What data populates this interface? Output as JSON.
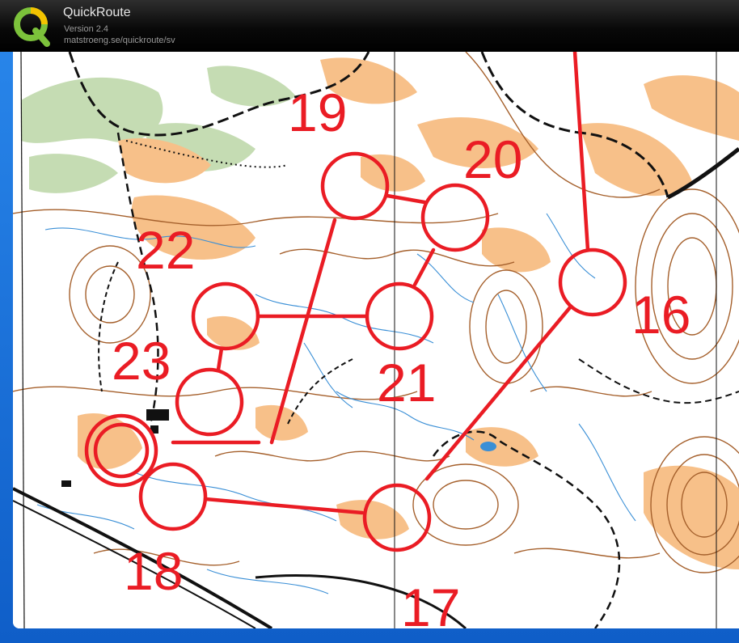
{
  "app": {
    "name": "QuickRoute",
    "version": "Version 2.4",
    "url": "matstroeng.se/quickroute/sv",
    "logo_letter": "Q"
  },
  "colors": {
    "course": "#ea1c24",
    "open_land": "#f7c089",
    "green": "#c5dcb3",
    "contour": "#a5602c",
    "water": "#3a8fd6",
    "path": "#111111"
  },
  "course": {
    "controls": [
      {
        "number": "16"
      },
      {
        "number": "17"
      },
      {
        "number": "18"
      },
      {
        "number": "19"
      },
      {
        "number": "20"
      },
      {
        "number": "21"
      },
      {
        "number": "22"
      },
      {
        "number": "23"
      }
    ]
  }
}
